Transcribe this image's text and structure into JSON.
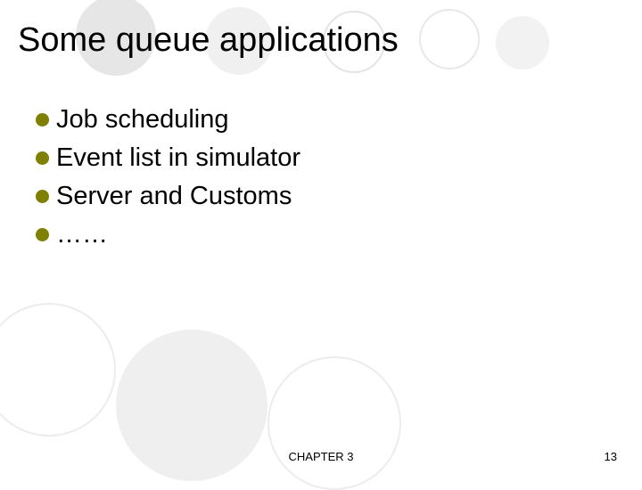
{
  "title": "Some queue applications",
  "bullets": [
    "Job scheduling",
    "Event list in simulator",
    "Server and Customs",
    "……"
  ],
  "footer": {
    "chapter": "CHAPTER 3",
    "page": "13"
  }
}
